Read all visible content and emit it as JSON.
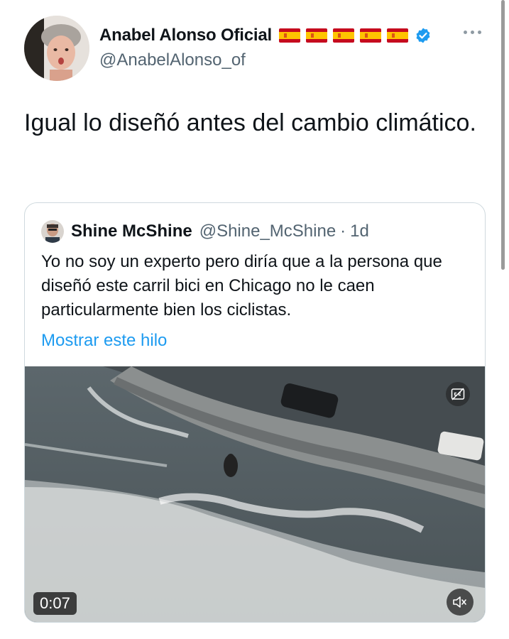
{
  "author": {
    "display_name": "Anabel Alonso Oficial",
    "handle": "@AnabelAlonso_of",
    "flag_icons": [
      "spain-flag-icon",
      "spain-flag-icon",
      "spain-flag-icon",
      "spain-flag-icon",
      "spain-flag-icon"
    ],
    "verified_icon": "verified-badge-icon",
    "verified_color": "#1d9bf0"
  },
  "tweet": {
    "text": "Igual lo diseñó antes del cambio climático."
  },
  "quoted_tweet": {
    "display_name": "Shine McShine",
    "handle": "@Shine_McShine",
    "separator": "·",
    "time": "1d",
    "text": "Yo no soy un experto pero diría que a la persona que diseñó este carril bici en Chicago no le caen particularmente bien los ciclistas.",
    "show_thread_link": "Mostrar este hilo",
    "link_color": "#1d9bf0",
    "video": {
      "duration": "0:07",
      "captions_icon": "closed-captions-icon",
      "mute_icon": "volume-muted-icon"
    }
  }
}
